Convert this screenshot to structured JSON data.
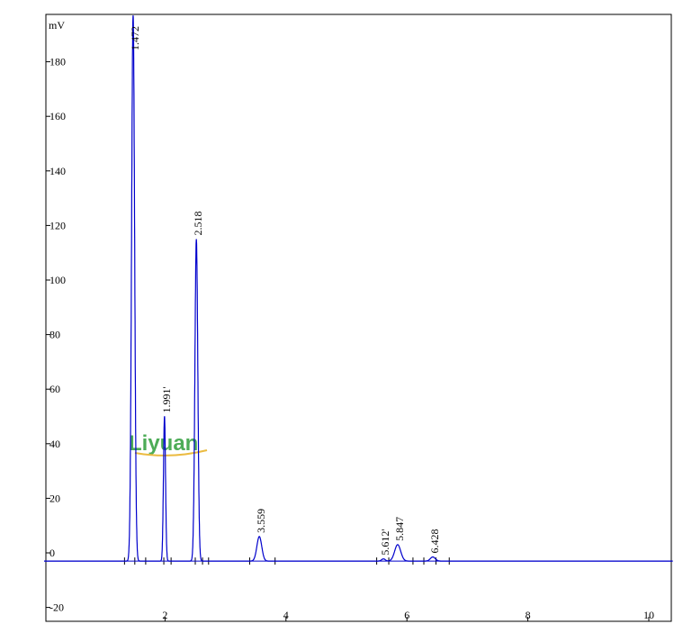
{
  "chart_data": {
    "type": "line",
    "ylabel": "mV",
    "xlim": [
      0.0,
      10.4
    ],
    "ylim": [
      -23,
      198
    ],
    "x_ticks": [
      2,
      4,
      6,
      8,
      10
    ],
    "y_ticks": [
      -20,
      0,
      20,
      40,
      60,
      80,
      100,
      120,
      140,
      160,
      180
    ],
    "grid": false,
    "baseline": -3,
    "series": [
      {
        "peaks": [
          {
            "label": "1.472",
            "rt": 1.472,
            "height": 200,
            "width": 0.025
          },
          {
            "label": "1.991'",
            "rt": 1.991,
            "height": 53,
            "width": 0.017
          },
          {
            "label": "2.518",
            "rt": 2.518,
            "height": 118,
            "width": 0.024
          },
          {
            "label": "3.559",
            "rt": 3.559,
            "height": 9,
            "width": 0.04
          },
          {
            "label": "5.612'",
            "rt": 5.612,
            "height": 0.8,
            "width": 0.03
          },
          {
            "label": "5.847",
            "rt": 5.847,
            "height": 6,
            "width": 0.05
          },
          {
            "label": "6.428",
            "rt": 6.428,
            "height": 1.5,
            "width": 0.04
          }
        ]
      }
    ],
    "integration_markers": [
      1.33,
      1.5,
      1.68,
      1.98,
      2.1,
      2.5,
      2.62,
      2.72,
      3.4,
      3.82,
      5.5,
      5.7,
      6.1,
      6.28,
      6.48,
      6.7
    ]
  },
  "watermark": {
    "text": "Liyuan",
    "color_primary": "#2f9e3a",
    "color_accent": "#e8b020"
  },
  "colors": {
    "trace": "#0000cc",
    "axis": "#000000",
    "baseline": "#0000cc"
  }
}
